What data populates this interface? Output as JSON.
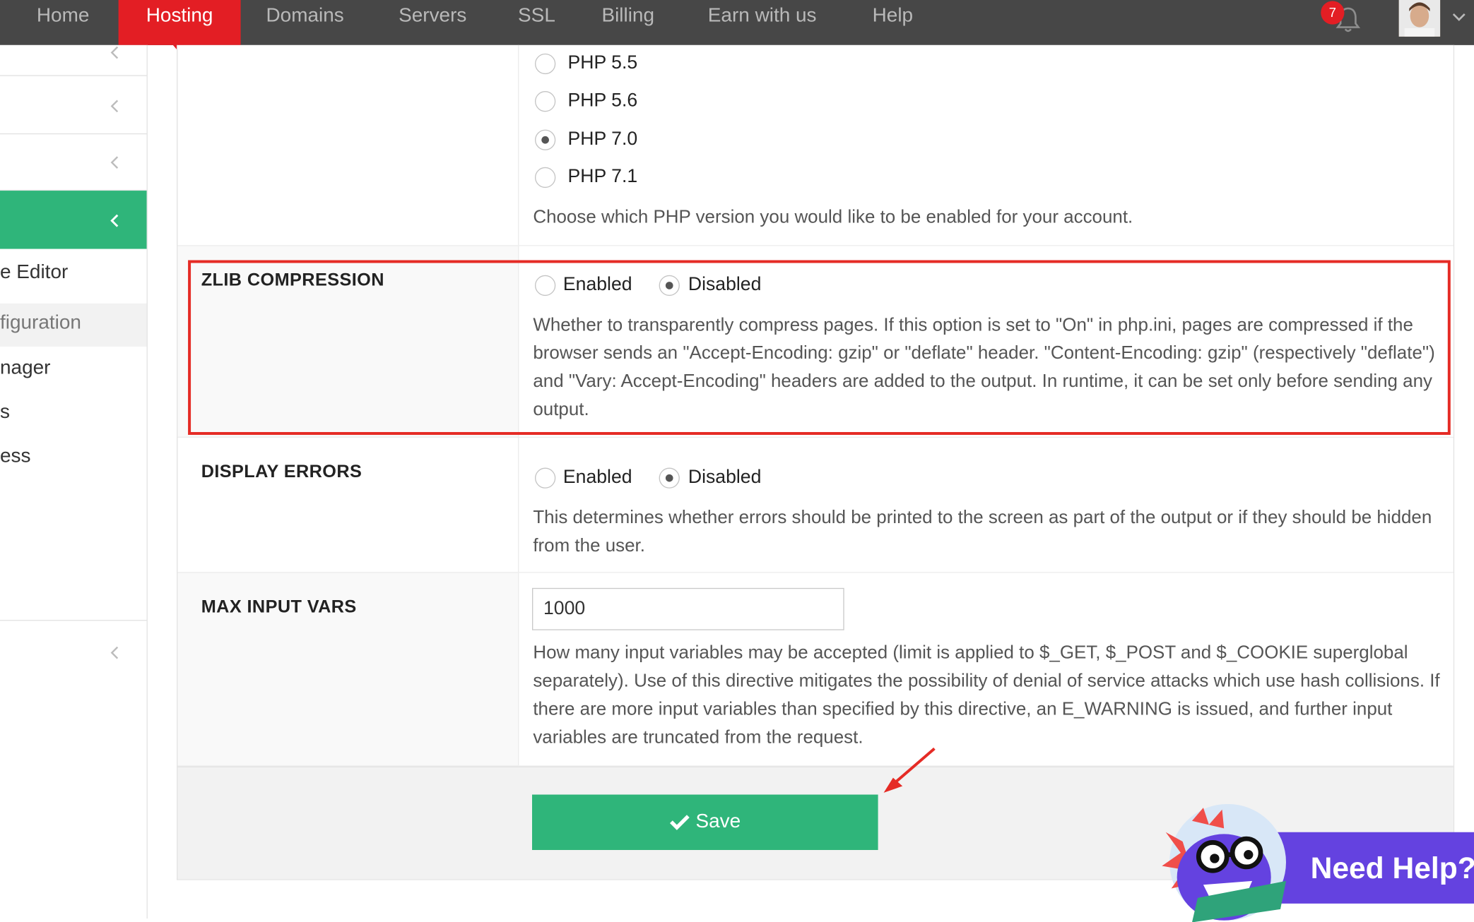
{
  "nav": {
    "items": [
      "Home",
      "Hosting",
      "Domains",
      "Servers",
      "SSL",
      "Billing",
      "Earn with us",
      "Help"
    ],
    "active": "Hosting",
    "notification_count": "7"
  },
  "sidebar": {
    "links": [
      "e Editor",
      "figuration",
      "nager",
      "s",
      "ess"
    ],
    "active_link": "figuration"
  },
  "php_version": {
    "options": [
      "PHP 5.5",
      "PHP 5.6",
      "PHP 7.0",
      "PHP 7.1"
    ],
    "selected": "PHP 7.0",
    "description": "Choose which PHP version you would like to be enabled for your account."
  },
  "zlib": {
    "label": "ZLIB COMPRESSION",
    "option_enabled": "Enabled",
    "option_disabled": "Disabled",
    "selected": "Disabled",
    "description": "Whether to transparently compress pages. If this option is set to \"On\" in php.ini, pages are compressed if the browser sends an \"Accept-Encoding: gzip\" or \"deflate\" header. \"Content-Encoding: gzip\" (respectively \"deflate\") and \"Vary: Accept-Encoding\" headers are added to the output. In runtime, it can be set only before sending any output."
  },
  "display_errors": {
    "label": "DISPLAY ERRORS",
    "option_enabled": "Enabled",
    "option_disabled": "Disabled",
    "selected": "Disabled",
    "description": "This determines whether errors should be printed to the screen as part of the output or if they should be hidden from the user."
  },
  "max_input_vars": {
    "label": "MAX INPUT VARS",
    "value": "1000",
    "description": "How many input variables may be accepted (limit is applied to $_GET, $_POST and $_COOKIE superglobal separately). Use of this directive mitigates the possibility of denial of service attacks which use hash collisions. If there are more input variables than specified by this directive, an E_WARNING is issued, and further input variables are truncated from the request."
  },
  "save_label": "Save",
  "help_widget": {
    "label": "Need Help?"
  },
  "colors": {
    "nav_bg": "#474747",
    "active_red": "#e31e24",
    "green": "#2fb57a",
    "highlight": "#e52b25",
    "help_purple": "#6442e0"
  }
}
